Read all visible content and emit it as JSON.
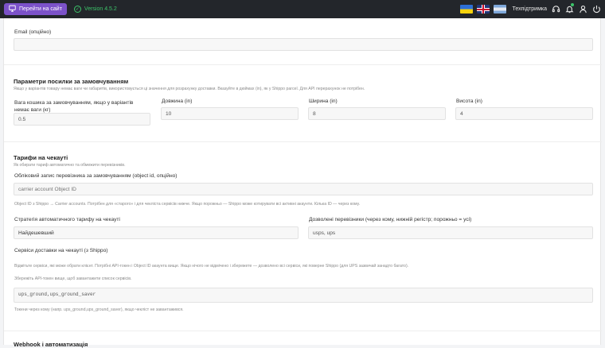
{
  "topbar": {
    "site_button_label": "Перейти на сайт",
    "version_label": "Version 4.5.2",
    "support_label": "Техпідтримка"
  },
  "email": {
    "label": "Email (опційно)",
    "value": ""
  },
  "parcel": {
    "heading": "Параметри посилки за замовчуванням",
    "hint": "Якщо у варіантів товару немає ваги чи габаритів, використовується ці значення для розрахунку доставки. Вказуйте в дюймах (in), як у Shippo parcel. Для API перерахунок не потрібен.",
    "weight_label_line1": "Вага кошика за замовчуванням, якщо у варіантів",
    "weight_label_line2": "немає ваги (кг)",
    "weight_value": "0.5",
    "length_label": "Довжина (in)",
    "length_value": "10",
    "width_label": "Ширина (in)",
    "width_value": "8",
    "height_label": "Висота (in)",
    "height_value": "4"
  },
  "rates": {
    "heading": "Тарифи на чекауті",
    "hint": "Як обирати тариф автоматично та обмежити перевізників.",
    "carrier_account_label": "Обліковий запис перевізника за замовчуванням (object id, опційно)",
    "carrier_account_placeholder": "carrier account Object ID",
    "carrier_account_hint": "Object ID з Shippo → Carrier accounts. Потрібен для «старого» і для чекліста сервісів нижче. Якщо порожньо — Shippo може котирувати всі активні акаунти. Кілька ID — через кому.",
    "strategy_label": "Стратегія автоматичного тарифу на чекауті",
    "strategy_value": "Найдешевший",
    "allowed_label": "Дозволені перевізники (через кому, нижній регістр; порожньо = усі)",
    "allowed_value": "usps, ups",
    "services_label": "Сервіси доставки на чекауті (з Shippo)",
    "services_hint1": "Відмітьте сервіси, які може обрати клієнт. Потрібні API-токен і Object ID акаунта вище. Якщо нічого не відмічено і збережете — дозволено всі сервіси, які поверне Shippo (для UPS зазвичай занадто багато).",
    "services_hint2": "Збережіть API-токен вище, щоб завантажити список сервісів.",
    "services_value": "ups_ground,ups_ground_saver",
    "services_hint3": "Токени через кому (напр. ups_ground,ups_ground_saver), якщо чекліст не завантажився."
  },
  "next_section": {
    "heading": "Webhook і автоматизація"
  }
}
